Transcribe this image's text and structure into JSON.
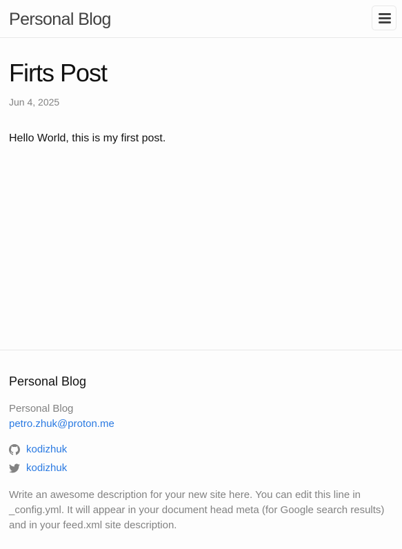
{
  "header": {
    "site_title": "Personal Blog",
    "menu_icon": "hamburger-menu-icon"
  },
  "post": {
    "title": "Firts Post",
    "date": "Jun 4, 2025",
    "body": "Hello World, this is my first post."
  },
  "footer": {
    "heading": "Personal Blog",
    "name": "Personal Blog",
    "email": "petro.zhuk@proton.me",
    "social": [
      {
        "icon": "github-icon",
        "label": "kodizhuk"
      },
      {
        "icon": "twitter-icon",
        "label": "kodizhuk"
      }
    ],
    "description": "Write an awesome description for your new site here. You can edit this line in _config.yml. It will appear in your document head meta (for Google search results) and in your feed.xml site description."
  },
  "colors": {
    "background": "#fdfdfd",
    "text": "#111111",
    "muted": "#828282",
    "link": "#2a7ae2",
    "border": "#e8e8e8"
  }
}
